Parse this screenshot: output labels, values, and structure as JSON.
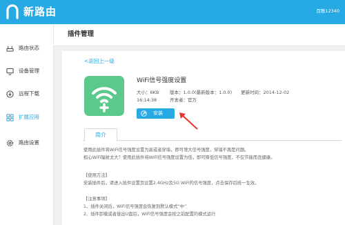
{
  "header": {
    "brand": "新路由",
    "account": "百歌12340",
    "brand_color": "#27a9e3"
  },
  "sidebar": {
    "items": [
      {
        "label": "路由状态",
        "icon": "router-icon"
      },
      {
        "label": "设备管理",
        "icon": "monitor-icon"
      },
      {
        "label": "远程下载",
        "icon": "download-icon"
      },
      {
        "label": "扩展应用",
        "icon": "apps-icon",
        "active": true
      },
      {
        "label": "路由设置",
        "icon": "gear-icon"
      }
    ]
  },
  "page": {
    "title": "插件管理"
  },
  "plugin": {
    "back": "<返回上一级",
    "name": "WiFi信号强度设置",
    "size": "大小：6KB",
    "version": "版本：1.0.0(最新版本：1.0.0)",
    "updated": "更新时间：2014-12-02",
    "time": "16:14:38",
    "developer": "开发者：官方",
    "install_label": "安装",
    "icon_color": "#5cc98c"
  },
  "tabs": [
    "简介"
  ],
  "description": [
    "使用此插件将WiFi信号强度设置为高或者穿墙，即可增大信号强度，穿墙不再是问题。",
    "担心WiFi辐射太大？使用此插件将WiFi信号强度设置为低，即可降低信号强度，不仅节能而且健康。",
    "",
    "【使用方法】",
    "安装插件后，请进入插件设置页设置2.4GHz及5G WiFi的信号强度，点击保存后统一生效。",
    "",
    "【注意事项】",
    "1、插件关闭后，WiFi信号强度会恢复到默认模式“中”",
    "2、插件卸载或者拔出U盘后，WiFi信号强度会按之前配置的模式运行"
  ]
}
